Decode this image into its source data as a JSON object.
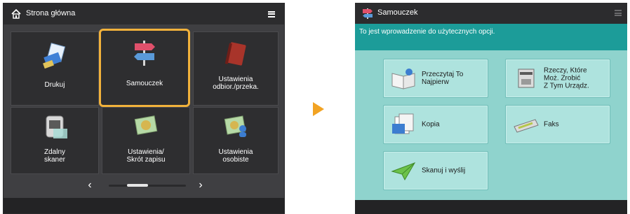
{
  "left_screen": {
    "title": "Strona główna",
    "tiles": [
      {
        "label": "Drukuj",
        "icon": "print-icon"
      },
      {
        "label": "Samouczek",
        "icon": "signpost-icon",
        "selected": true
      },
      {
        "label": "Ustawienia\nodbior./przeka.",
        "icon": "book-icon"
      },
      {
        "label": "Zdalny\nskaner",
        "icon": "scanner-icon"
      },
      {
        "label": "Ustawienia/\nSkrót zapisu",
        "icon": "settings-paper-icon"
      },
      {
        "label": "Ustawienia\nosobiste",
        "icon": "personal-settings-icon"
      }
    ],
    "pager": {
      "prev": "‹",
      "next": "›"
    }
  },
  "right_screen": {
    "title": "Samouczek",
    "intro": "To jest wprowadzenie do użytecznych opcji.",
    "buttons": [
      {
        "label": "Przeczytaj To\nNajpierw",
        "icon": "read-first-icon"
      },
      {
        "label": "Rzeczy, Które\nMoż. Zrobić\nZ Tym Urządz.",
        "icon": "device-icon"
      },
      {
        "label": "Kopia",
        "icon": "copy-icon"
      },
      {
        "label": "Faks",
        "icon": "fax-icon"
      },
      {
        "label": "Skanuj i wyślij",
        "icon": "scan-send-icon"
      }
    ]
  },
  "colors": {
    "selection": "#f2b23b",
    "arrow": "#f2a323",
    "teal": "#1c9c99",
    "panel_bg": "#8fd3cd"
  }
}
